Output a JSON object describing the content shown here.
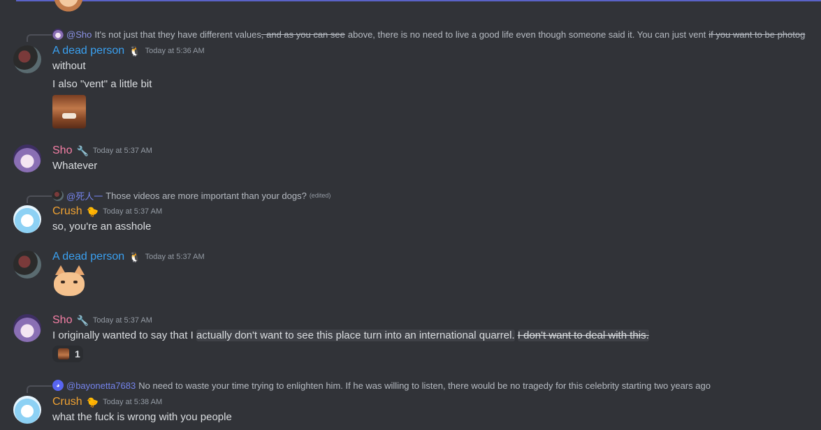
{
  "messages": [
    {
      "reply": {
        "mention": "@Sho",
        "text_before": "It's not just that they have different values",
        "strike1": ", and as you can see",
        "text_middle": "above, there is no need to live a good life even though someone said it. You can just vent",
        "strike2": "if you want to be photog"
      },
      "author": "A dead person",
      "role_icon": "🐧",
      "timestamp": "Today at 5:36 AM",
      "lines": [
        "without",
        "I also \"vent\" a little bit"
      ]
    },
    {
      "author": "Sho",
      "role_icon": "🔧",
      "timestamp": "Today at 5:37 AM",
      "lines": [
        "Whatever"
      ]
    },
    {
      "reply": {
        "mention": "@死人一",
        "text": "Those videos are more important than your dogs?",
        "edited": "(edited)"
      },
      "author": "Crush",
      "role_icon": "🐤",
      "timestamp": "Today at 5:37 AM",
      "lines": [
        "so, you're an asshole"
      ]
    },
    {
      "author": "A dead person",
      "role_icon": "🐧",
      "timestamp": "Today at 5:37 AM"
    },
    {
      "author": "Sho",
      "role_icon": "🔧",
      "timestamp": "Today at 5:37 AM",
      "text_plain": "I originally wanted to say that I",
      "text_highlight": "actually don't want to see this place turn into an international quarrel.",
      "text_strike": "I don't want to deal with this.",
      "reaction_count": "1"
    },
    {
      "reply": {
        "mention": "@bayonetta7683",
        "text": "No need to waste your time trying to enlighten him. If he was willing to listen, there would be no tragedy for this celebrity starting two years ago"
      },
      "author": "Crush",
      "role_icon": "🐤",
      "timestamp": "Today at 5:38 AM",
      "lines": [
        "what the fuck is wrong with you people"
      ]
    }
  ],
  "colors": {
    "background": "#313338",
    "text": "#dbdee1",
    "name_dead": "#3aa0f0",
    "name_sho": "#f47fa5",
    "name_crush": "#f0a232"
  }
}
